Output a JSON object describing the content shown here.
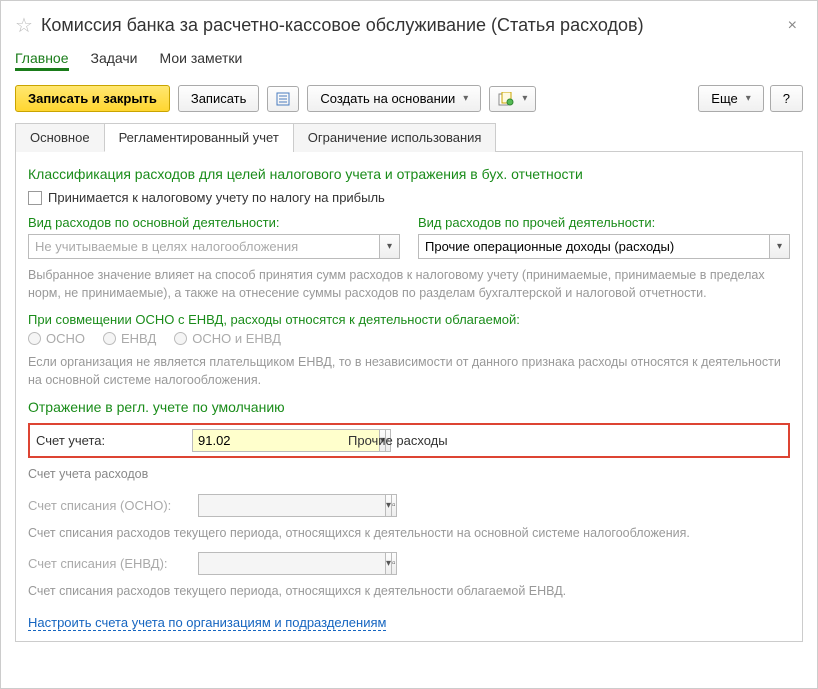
{
  "title": "Комиссия банка за расчетно-кассовое обслуживание (Статья расходов)",
  "nav_tabs": {
    "main": "Главное",
    "tasks": "Задачи",
    "notes": "Мои заметки"
  },
  "toolbar": {
    "save_close": "Записать и закрыть",
    "save": "Записать",
    "create_based": "Создать на основании",
    "more": "Еще",
    "help": "?"
  },
  "subtabs": {
    "main": "Основное",
    "regulated": "Регламентированный учет",
    "restriction": "Ограничение использования"
  },
  "section1": {
    "title": "Классификация расходов для целей налогового учета и отражения в бух. отчетности",
    "checkbox_label": "Принимается к налоговому учету по налогу на прибыль",
    "main_activity_label": "Вид расходов по основной деятельности:",
    "main_activity_value": "Не учитываемые в целях налогообложения",
    "other_activity_label": "Вид расходов по прочей деятельности:",
    "other_activity_value": "Прочие операционные доходы (расходы)",
    "help1": "Выбранное значение влияет на способ принятия сумм расходов к налоговому учету (принимаемые, принимаемые в пределах норм, не принимаемые), а также на отнесение суммы расходов по разделам бухгалтерской и налоговой отчетности.",
    "combine_label": "При совмещении ОСНО с ЕНВД, расходы относятся к деятельности облагаемой:",
    "radio_osno": "ОСНО",
    "radio_envd": "ЕНВД",
    "radio_both": "ОСНО и ЕНВД",
    "help2": "Если организация не является плательщиком ЕНВД, то в независимости от данного признака расходы относятся к деятельности на основной системе налогообложения."
  },
  "section2": {
    "title": "Отражение в регл. учете по умолчанию",
    "account_label": "Счет учета:",
    "account_value": "91.02",
    "account_desc": "Прочие расходы",
    "expense_account": "Счет учета расходов",
    "writeoff_osno_label": "Счет списания (ОСНО):",
    "help3": "Счет списания расходов текущего периода, относящихся к деятельности на основной системе налогообложения.",
    "writeoff_envd_label": "Счет списания (ЕНВД):",
    "help4": "Счет списания расходов текущего периода, относящихся к деятельности облагаемой ЕНВД.",
    "configure_link": "Настроить счета учета по организациям и подразделениям"
  }
}
